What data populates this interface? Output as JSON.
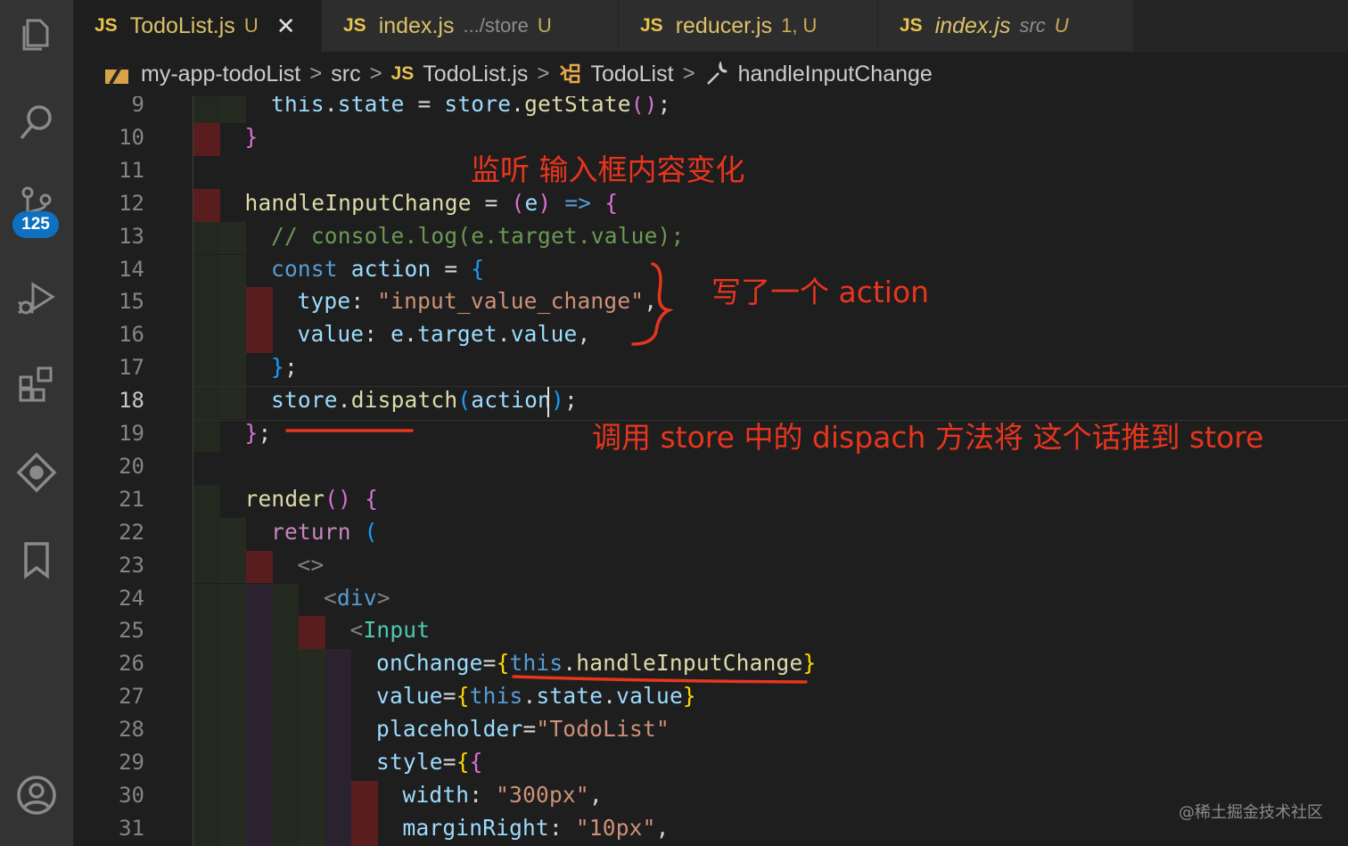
{
  "tabs": [
    {
      "label": "TodoList.js",
      "hint": "",
      "mod": "U",
      "active": true,
      "italic": false,
      "close": "✕"
    },
    {
      "label": "index.js",
      "hint": ".../store",
      "mod": "U",
      "active": false,
      "italic": false
    },
    {
      "label": "reducer.js",
      "hint": "",
      "mod": "1, U",
      "active": false,
      "italic": false
    },
    {
      "label": "index.js",
      "hint": "src",
      "mod": "U",
      "active": false,
      "italic": true
    }
  ],
  "tab_file_type": "JS",
  "breadcrumb": [
    "my-app-todoList",
    "src",
    "TodoList.js",
    "TodoList",
    "handleInputChange"
  ],
  "scm_badge": "125",
  "line_numbers": [
    "9",
    "10",
    "11",
    "12",
    "13",
    "14",
    "15",
    "16",
    "17",
    "18",
    "19",
    "20",
    "21",
    "22",
    "23",
    "24",
    "25",
    "26",
    "27",
    "28",
    "29",
    "30",
    "31"
  ],
  "current_line": "18",
  "code": [
    [
      [
        "var",
        "this"
      ],
      [
        "pun",
        "."
      ],
      [
        "var",
        "state"
      ],
      [
        "pun",
        " = "
      ],
      [
        "var",
        "store"
      ],
      [
        "pun",
        "."
      ],
      [
        "fn",
        "getState"
      ],
      [
        "br2",
        "()"
      ],
      [
        "pun",
        ";"
      ]
    ],
    [
      [
        "br2",
        "}"
      ]
    ],
    [],
    [
      [
        "fn",
        "handleInputChange"
      ],
      [
        "pun",
        " = "
      ],
      [
        "br2",
        "("
      ],
      [
        "var",
        "e"
      ],
      [
        "br2",
        ")"
      ],
      [
        "kw",
        " =>"
      ],
      [
        "pun",
        " "
      ],
      [
        "br2",
        "{"
      ]
    ],
    [
      [
        "cm",
        "// console.log(e.target.value);"
      ]
    ],
    [
      [
        "kw",
        "const"
      ],
      [
        "pun",
        " "
      ],
      [
        "var",
        "action"
      ],
      [
        "pun",
        " = "
      ],
      [
        "br3",
        "{"
      ]
    ],
    [
      [
        "prop",
        "type"
      ],
      [
        "pun",
        ": "
      ],
      [
        "str",
        "\"input_value_change\""
      ],
      [
        "pun",
        ","
      ]
    ],
    [
      [
        "prop",
        "value"
      ],
      [
        "pun",
        ": "
      ],
      [
        "var",
        "e"
      ],
      [
        "pun",
        "."
      ],
      [
        "var",
        "target"
      ],
      [
        "pun",
        "."
      ],
      [
        "var",
        "value"
      ],
      [
        "pun",
        ","
      ]
    ],
    [
      [
        "br3",
        "}"
      ],
      [
        "pun",
        ";"
      ]
    ],
    [
      [
        "var",
        "store"
      ],
      [
        "pun",
        "."
      ],
      [
        "fn",
        "dispatch"
      ],
      [
        "br3",
        "("
      ],
      [
        "var",
        "action"
      ],
      [
        "br3",
        ")"
      ],
      [
        "pun",
        ";"
      ]
    ],
    [
      [
        "br2",
        "}"
      ],
      [
        "pun",
        ";"
      ]
    ],
    [],
    [
      [
        "fn",
        "render"
      ],
      [
        "br2",
        "()"
      ],
      [
        "pun",
        " "
      ],
      [
        "br2",
        "{"
      ]
    ],
    [
      [
        "kw2",
        "return"
      ],
      [
        "pun",
        " "
      ],
      [
        "br3",
        "("
      ]
    ],
    [
      [
        "gray",
        "<>"
      ]
    ],
    [
      [
        "gray",
        "<"
      ],
      [
        "tag",
        "div"
      ],
      [
        "gray",
        ">"
      ]
    ],
    [
      [
        "gray",
        "<"
      ],
      [
        "jsx",
        "Input"
      ]
    ],
    [
      [
        "attr",
        "onChange"
      ],
      [
        "pun",
        "="
      ],
      [
        "br1",
        "{"
      ],
      [
        "kw",
        "this"
      ],
      [
        "pun",
        "."
      ],
      [
        "fn",
        "handleInputChange"
      ],
      [
        "br1",
        "}"
      ]
    ],
    [
      [
        "attr",
        "value"
      ],
      [
        "pun",
        "="
      ],
      [
        "br1",
        "{"
      ],
      [
        "kw",
        "this"
      ],
      [
        "pun",
        "."
      ],
      [
        "var",
        "state"
      ],
      [
        "pun",
        "."
      ],
      [
        "var",
        "value"
      ],
      [
        "br1",
        "}"
      ]
    ],
    [
      [
        "attr",
        "placeholder"
      ],
      [
        "pun",
        "="
      ],
      [
        "str",
        "\"TodoList\""
      ]
    ],
    [
      [
        "attr",
        "style"
      ],
      [
        "pun",
        "="
      ],
      [
        "br1",
        "{"
      ],
      [
        "br2",
        "{"
      ]
    ],
    [
      [
        "prop",
        "width"
      ],
      [
        "pun",
        ": "
      ],
      [
        "str",
        "\"300px\""
      ],
      [
        "pun",
        ","
      ]
    ],
    [
      [
        "prop",
        "marginRight"
      ],
      [
        "pun",
        ": "
      ],
      [
        "str",
        "\"10px\""
      ],
      [
        "pun",
        ","
      ]
    ]
  ],
  "annotations": {
    "listen": "监听 输入框内容变化",
    "action": "写了一个 action",
    "dispatch": "调用 store 中的 dispach 方法将 这个话推到 store"
  },
  "watermark": "@稀土掘金技术社区",
  "colors": {
    "annotation": "#e8351e",
    "badge": "#0e70c0",
    "js_icon": "#e8c44c"
  }
}
